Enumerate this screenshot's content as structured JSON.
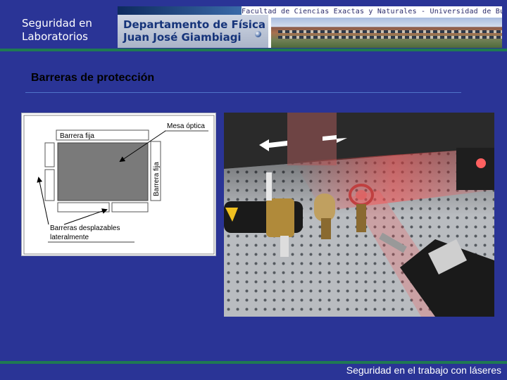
{
  "header": {
    "title_line1": "Seguridad en",
    "title_line2": "Laboratorios",
    "banner": {
      "faculty_text": "Facultad de Ciencias Exactas y Naturales - Universidad de Buenos Aires",
      "dept_line1": "Departamento de Física",
      "dept_line2": "Juan José Giambiagi"
    }
  },
  "section": {
    "title": "Barreras de protección"
  },
  "diagram": {
    "label_mesa": "Mesa óptica",
    "label_barrera_fija_top": "Barrera fija",
    "label_barrera_fija_side": "Barrera fija",
    "label_desplazables_line1": "Barreras desplazables",
    "label_desplazables_line2": "lateralmente"
  },
  "footer": {
    "text": "Seguridad en el trabajo con láseres"
  },
  "colors": {
    "background": "#2a3496",
    "rule": "#1f7a52",
    "section_rule": "#4f73c8"
  }
}
